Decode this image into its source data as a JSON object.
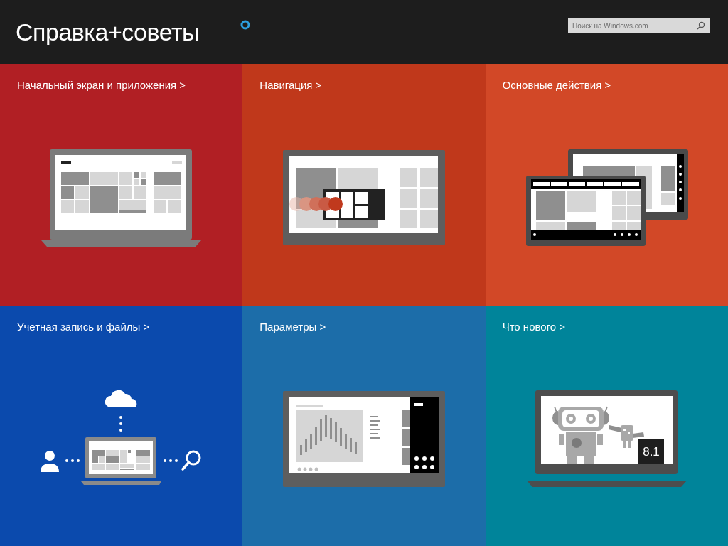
{
  "header": {
    "title": "Справка+советы",
    "search": {
      "placeholder": "Поиск на Windows.com"
    }
  },
  "tiles": [
    {
      "title": "Начальный экран и приложения >",
      "kind": "start",
      "color": "#b11f24"
    },
    {
      "title": "Навигация >",
      "kind": "navigation",
      "color": "#c0381b"
    },
    {
      "title": "Основные действия >",
      "kind": "basics",
      "color": "#d24827"
    },
    {
      "title": "Учетная запись и файлы >",
      "kind": "account",
      "color": "#0b4aad"
    },
    {
      "title": "Параметры >",
      "kind": "settings",
      "color": "#1c6da9"
    },
    {
      "title": "Что нового >",
      "kind": "whats_new",
      "color": "#00849a",
      "badge": "8.1"
    }
  ]
}
